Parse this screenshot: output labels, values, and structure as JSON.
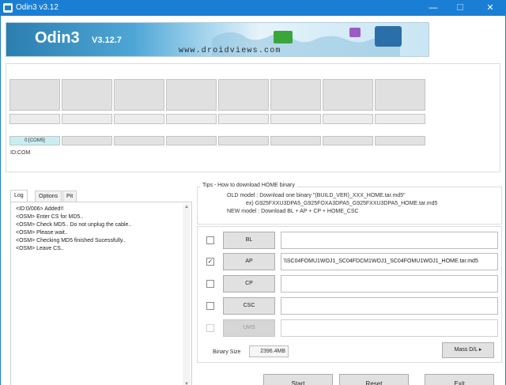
{
  "window": {
    "title": "Odin3 v3.12",
    "min": "—",
    "max": "☐",
    "close": "✕"
  },
  "banner": {
    "logo": "Odin3",
    "version": "V3.12.7",
    "site": "www.droidviews.com"
  },
  "ports": {
    "com_label": "0:[COM5]",
    "id_com": "ID:COM"
  },
  "tabs": [
    "Log",
    "Options",
    "Pit"
  ],
  "log": [
    "<ID:0/006> Added!!",
    "<OSM> Enter CS for MD5..",
    "<OSM> Check MD5.. Do not unplug the cable..",
    "<OSM> Please wait..",
    "<OSM> Checking MD5 finished Sucessfully..",
    "<OSM> Leave CS.."
  ],
  "tips": {
    "title": "Tips - How to download HOME binary",
    "old_model": "OLD model  : Download one binary    \"(BUILD_VER)_XXX_HOME.tar.md5\"",
    "example": "ex) G925FXXU3DPA5_G925FOXA3DPA5_G925FXXU3DPA5_HOME.tar.md5",
    "new_model": "NEW model : Download BL + AP + CP + HOME_CSC"
  },
  "files": [
    {
      "label": "BL",
      "checked": false,
      "enabled": true,
      "path": ""
    },
    {
      "label": "AP",
      "checked": true,
      "enabled": true,
      "path": "\\\\SC04FOMU1WOJ1_SC04FDCM1WOJ1_SC04FOMU1WOJ1_HOME.tar.md5"
    },
    {
      "label": "CP",
      "checked": false,
      "enabled": true,
      "path": ""
    },
    {
      "label": "CSC",
      "checked": false,
      "enabled": true,
      "path": ""
    },
    {
      "label": "UMS",
      "checked": false,
      "enabled": false,
      "path": ""
    }
  ],
  "binary": {
    "label": "Binary Size",
    "value": "2396.4MB"
  },
  "buttons": {
    "mass_dl": "Mass D/L ▸",
    "start": "Start",
    "reset": "Reset",
    "exit": "Exit"
  },
  "colors": {
    "titlebar": "#1a7fd4",
    "com_active": "#c9eef0"
  }
}
